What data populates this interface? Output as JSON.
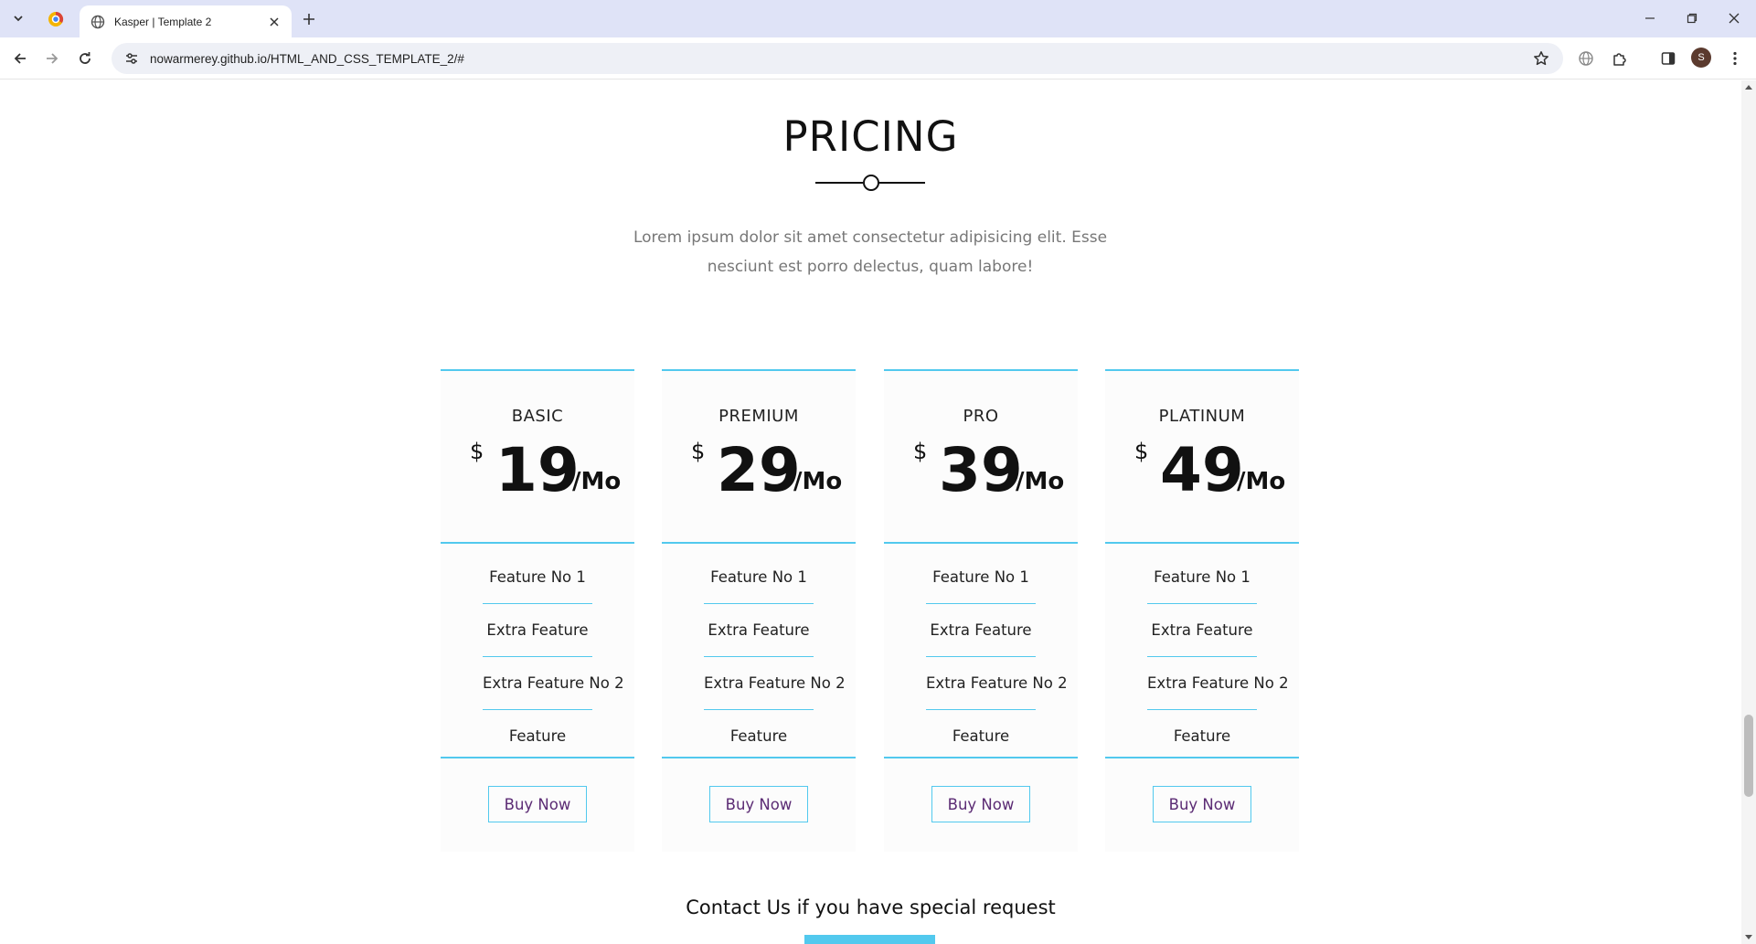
{
  "browser": {
    "tab_title": "Kasper | Template 2",
    "url": "nowarmerey.github.io/HTML_AND_CSS_TEMPLATE_2/#",
    "profile_initial": "S",
    "accent_color": "#dfe3f7"
  },
  "pricing": {
    "title": "PRICING",
    "description": "Lorem ipsum dolor sit amet consectetur adipisicing elit. Esse nesciunt est porro delectus, quam labore!",
    "accent_color": "#52c9ee",
    "plans": [
      {
        "name": "BASIC",
        "currency": "$",
        "amount": "19",
        "period": "/Mo",
        "features": [
          "Feature No 1",
          "Extra Feature",
          "Extra Feature No 2",
          "Feature"
        ],
        "button": "Buy Now"
      },
      {
        "name": "PREMIUM",
        "currency": "$",
        "amount": "29",
        "period": "/Mo",
        "features": [
          "Feature No 1",
          "Extra Feature",
          "Extra Feature No 2",
          "Feature"
        ],
        "button": "Buy Now"
      },
      {
        "name": "PRO",
        "currency": "$",
        "amount": "39",
        "period": "/Mo",
        "features": [
          "Feature No 1",
          "Extra Feature",
          "Extra Feature No 2",
          "Feature"
        ],
        "button": "Buy Now"
      },
      {
        "name": "PLATINUM",
        "currency": "$",
        "amount": "49",
        "period": "/Mo",
        "features": [
          "Feature No 1",
          "Extra Feature",
          "Extra Feature No 2",
          "Feature"
        ],
        "button": "Buy Now"
      }
    ]
  },
  "contact": {
    "text": "Contact Us if you have special request"
  },
  "icons": {
    "tab_list": "chevron-down-icon",
    "pinned_tab": "chrome-favicon-icon",
    "tab_favicon": "globe-icon",
    "close_tab": "close-icon",
    "new_tab": "plus-icon",
    "minimize": "minimize-icon",
    "restore": "restore-icon",
    "close_window": "close-icon",
    "back": "back-arrow-icon",
    "forward": "forward-arrow-icon",
    "reload": "reload-icon",
    "site_info": "tune-icon",
    "bookmark": "star-icon",
    "translate": "globe-icon",
    "extensions": "puzzle-icon",
    "side_panel": "side-panel-icon",
    "menu": "more-vertical-icon"
  }
}
